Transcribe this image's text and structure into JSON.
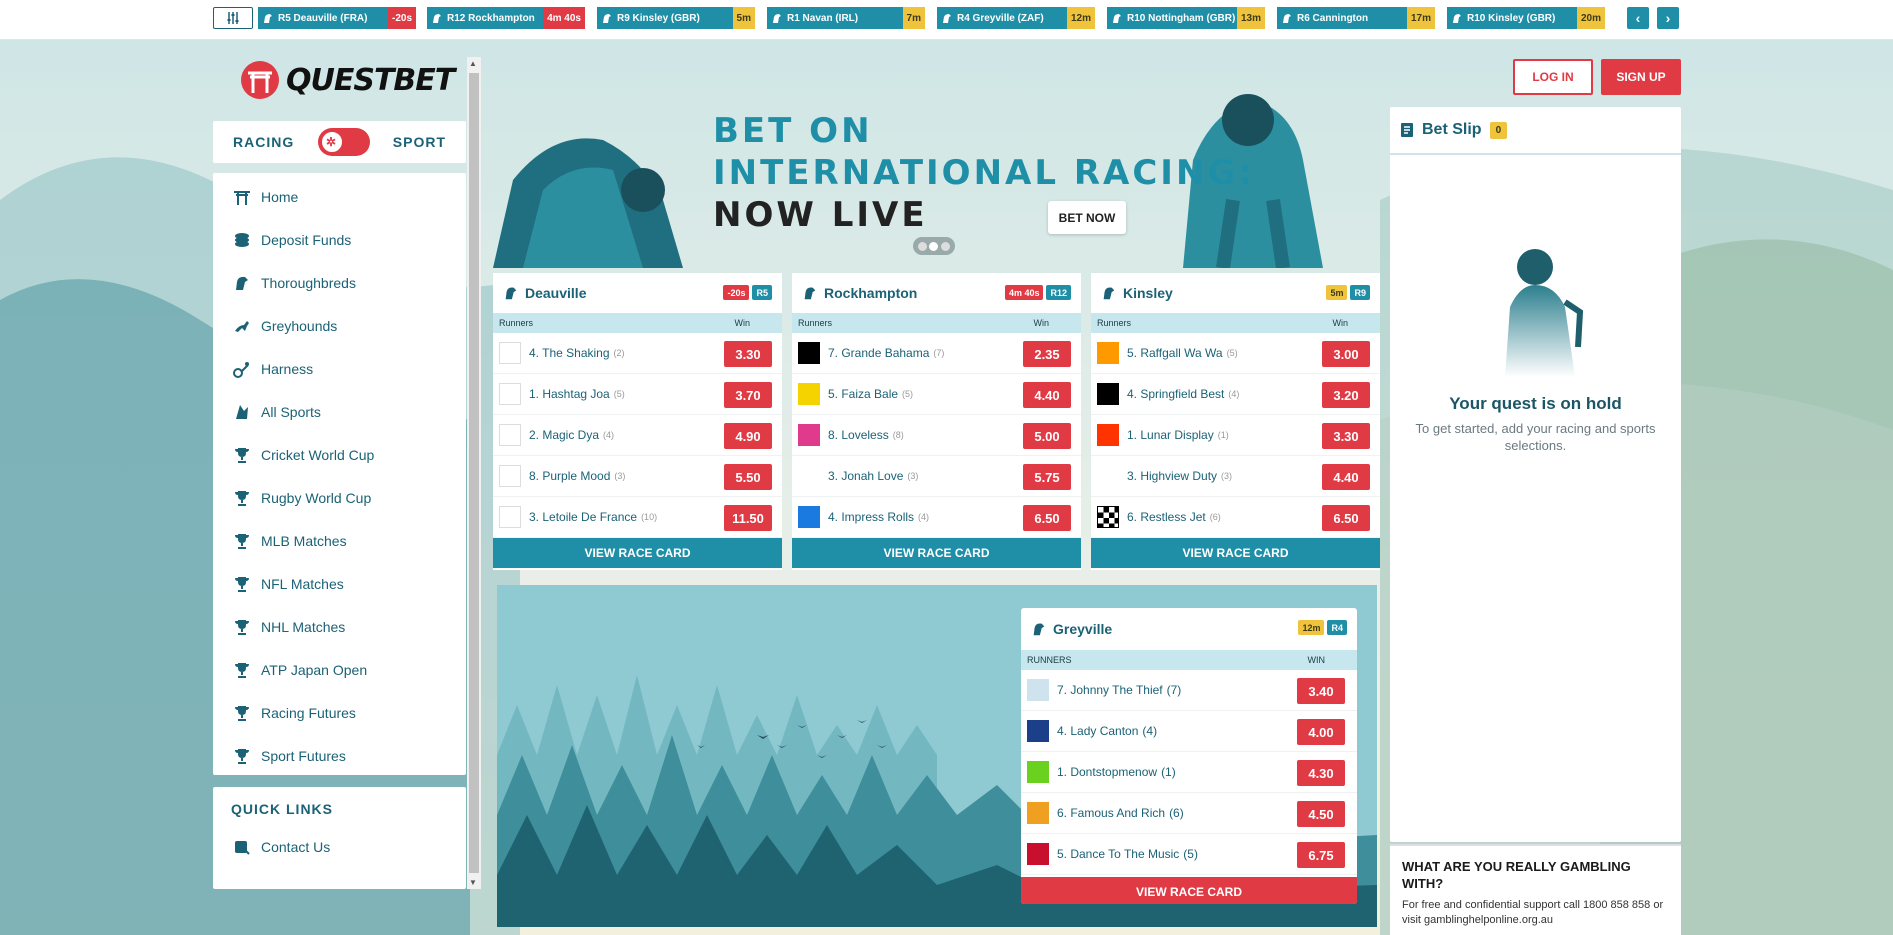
{
  "ticker": [
    {
      "race": "R5 Deauville (FRA)",
      "time": "-20s",
      "tone": "red"
    },
    {
      "race": "R12 Rockhampton",
      "time": "4m 40s",
      "tone": "red"
    },
    {
      "race": "R9 Kinsley (GBR)",
      "time": "5m",
      "tone": "yel"
    },
    {
      "race": "R1 Navan (IRL)",
      "time": "7m",
      "tone": "yel"
    },
    {
      "race": "R4 Greyville (ZAF)",
      "time": "12m",
      "tone": "yel"
    },
    {
      "race": "R10 Nottingham (GBR)",
      "time": "13m",
      "tone": "yel"
    },
    {
      "race": "R6 Cannington",
      "time": "17m",
      "tone": "yel"
    },
    {
      "race": "R10 Kinsley (GBR)",
      "time": "20m",
      "tone": "yel"
    }
  ],
  "brand": {
    "name": "QUESTBET"
  },
  "toggle": {
    "left": "RACING",
    "right": "SPORT"
  },
  "sidebar": {
    "items": [
      {
        "label": "Home",
        "icon": "torii-icon"
      },
      {
        "label": "Deposit Funds",
        "icon": "coins-icon"
      },
      {
        "label": "Thoroughbreds",
        "icon": "horse-icon"
      },
      {
        "label": "Greyhounds",
        "icon": "greyhound-icon"
      },
      {
        "label": "Harness",
        "icon": "harness-icon"
      },
      {
        "label": "All Sports",
        "icon": "sports-icon"
      },
      {
        "label": "Cricket World Cup",
        "icon": "trophy-icon"
      },
      {
        "label": "Rugby World Cup",
        "icon": "trophy-icon"
      },
      {
        "label": "MLB Matches",
        "icon": "trophy-icon"
      },
      {
        "label": "NFL Matches",
        "icon": "trophy-icon"
      },
      {
        "label": "NHL Matches",
        "icon": "trophy-icon"
      },
      {
        "label": "ATP Japan Open",
        "icon": "trophy-icon"
      },
      {
        "label": "Racing Futures",
        "icon": "trophy-icon"
      },
      {
        "label": "Sport Futures",
        "icon": "trophy-icon"
      }
    ]
  },
  "quick_links": {
    "title": "QUICK LINKS",
    "items": [
      {
        "label": "Contact Us",
        "icon": "contact-icon"
      }
    ]
  },
  "banner": {
    "line1": "BET ON",
    "line2": "INTERNATIONAL RACING:",
    "line3": "NOW LIVE",
    "cta": "BET NOW"
  },
  "race_cards": [
    {
      "venue": "Deauville",
      "time": "-20s",
      "time_tone": "red",
      "race": "R5",
      "col_runners": "Runners",
      "col_win": "Win",
      "button": "VIEW RACE CARD",
      "runners": [
        {
          "name": "4. The Shaking",
          "barrier": "(2)",
          "price": "3.30",
          "silk": "#ffffff"
        },
        {
          "name": "1. Hashtag Joa",
          "barrier": "(5)",
          "price": "3.70",
          "silk": "#ffffff"
        },
        {
          "name": "2. Magic Dya",
          "barrier": "(4)",
          "price": "4.90",
          "silk": "#ffffff"
        },
        {
          "name": "8. Purple Mood",
          "barrier": "(3)",
          "price": "5.50",
          "silk": "#ffffff"
        },
        {
          "name": "3. Letoile De France",
          "barrier": "(10)",
          "price": "11.50",
          "silk": "#ffffff"
        }
      ]
    },
    {
      "venue": "Rockhampton",
      "time": "4m 40s",
      "time_tone": "red",
      "race": "R12",
      "col_runners": "Runners",
      "col_win": "Win",
      "button": "VIEW RACE CARD",
      "runners": [
        {
          "name": "7. Grande Bahama",
          "barrier": "(7)",
          "price": "2.35",
          "silk": "#000000"
        },
        {
          "name": "5. Faiza Bale",
          "barrier": "(5)",
          "price": "4.40",
          "silk": "#f5d300"
        },
        {
          "name": "8. Loveless",
          "barrier": "(8)",
          "price": "5.00",
          "silk": "#e03a8c"
        },
        {
          "name": "3. Jonah Love",
          "barrier": "(3)",
          "price": "5.75",
          "silk": "#ffffff"
        },
        {
          "name": "4. Impress Rolls",
          "barrier": "(4)",
          "price": "6.50",
          "silk": "#1a7ae0"
        }
      ]
    },
    {
      "venue": "Kinsley",
      "time": "5m",
      "time_tone": "yel",
      "race": "R9",
      "col_runners": "Runners",
      "col_win": "Win",
      "button": "VIEW RACE CARD",
      "runners": [
        {
          "name": "5. Raffgall Wa Wa",
          "barrier": "(5)",
          "price": "3.00",
          "silk": "#ff9900"
        },
        {
          "name": "4. Springfield Best",
          "barrier": "(4)",
          "price": "3.20",
          "silk": "#000000"
        },
        {
          "name": "1. Lunar Display",
          "barrier": "(1)",
          "price": "3.30",
          "silk": "#ff3300"
        },
        {
          "name": "3. Highview Duty",
          "barrier": "(3)",
          "price": "4.40",
          "silk": "#ffffff"
        },
        {
          "name": "6. Restless Jet",
          "barrier": "(6)",
          "price": "6.50",
          "silk": "checker"
        }
      ]
    }
  ],
  "featured": {
    "venue": "Greyville",
    "time": "12m",
    "race": "R4",
    "col_runners": "RUNNERS",
    "col_win": "WIN",
    "button": "VIEW RACE CARD",
    "runners": [
      {
        "name": "7. Johnny The Thief",
        "barrier": "(7)",
        "price": "3.40",
        "silk": "#cfe3ef"
      },
      {
        "name": "4. Lady Canton",
        "barrier": "(4)",
        "price": "4.00",
        "silk": "#1c3f8a"
      },
      {
        "name": "1. Dontstopmenow",
        "barrier": "(1)",
        "price": "4.30",
        "silk": "#6ad11e"
      },
      {
        "name": "6. Famous And Rich",
        "barrier": "(6)",
        "price": "4.50",
        "silk": "#f0a020"
      },
      {
        "name": "5. Dance To The Music",
        "barrier": "(5)",
        "price": "6.75",
        "silk": "#c8102e"
      }
    ]
  },
  "auth": {
    "login": "LOG IN",
    "signup": "SIGN UP"
  },
  "betslip": {
    "title": "Bet Slip",
    "count": "0",
    "empty_title": "Your quest is on hold",
    "empty_text": "To get started, add your racing and sports selections."
  },
  "gambling": {
    "title": "WHAT ARE YOU REALLY GAMBLING WITH?",
    "text": "For free and confidential support call 1800 858 858 or visit gamblinghelponline.org.au"
  },
  "colors": {
    "accent": "#1f8fa8",
    "brand_red": "#e03a45",
    "warning": "#f0c33c",
    "text": "#1b6276"
  }
}
